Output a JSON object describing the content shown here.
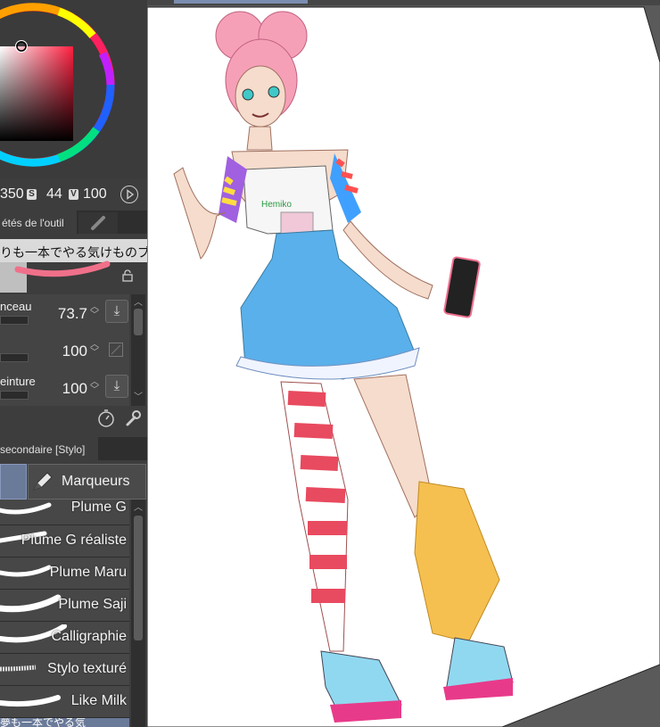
{
  "color": {
    "h": "350",
    "s": "44",
    "v": "100",
    "h_tag": "",
    "s_tag": "S",
    "v_tag": "V"
  },
  "tool_property": {
    "tab_label": "étés de l'outil",
    "brush_name": "りも一本でやる気けものブラシ",
    "props": [
      {
        "label": "nceau",
        "value": "73.7"
      },
      {
        "label": "",
        "value": "100"
      },
      {
        "label": "einture",
        "value": "100"
      }
    ]
  },
  "subtool": {
    "tab_label": "secondaire [Stylo]",
    "group_label": "Marqueurs",
    "brushes": [
      "Plume G",
      "Plume G réaliste",
      "Plume Maru",
      "Plume Saji",
      "Calligraphie",
      "Stylo texturé",
      "Like Milk"
    ],
    "bottom_item": "夢も一本でやる気"
  },
  "artwork": {
    "shirt_text": "Hemiko"
  },
  "colors": {
    "panel": "#3d3d3d",
    "accent": "#f06080",
    "canvas": "#ffffff"
  }
}
